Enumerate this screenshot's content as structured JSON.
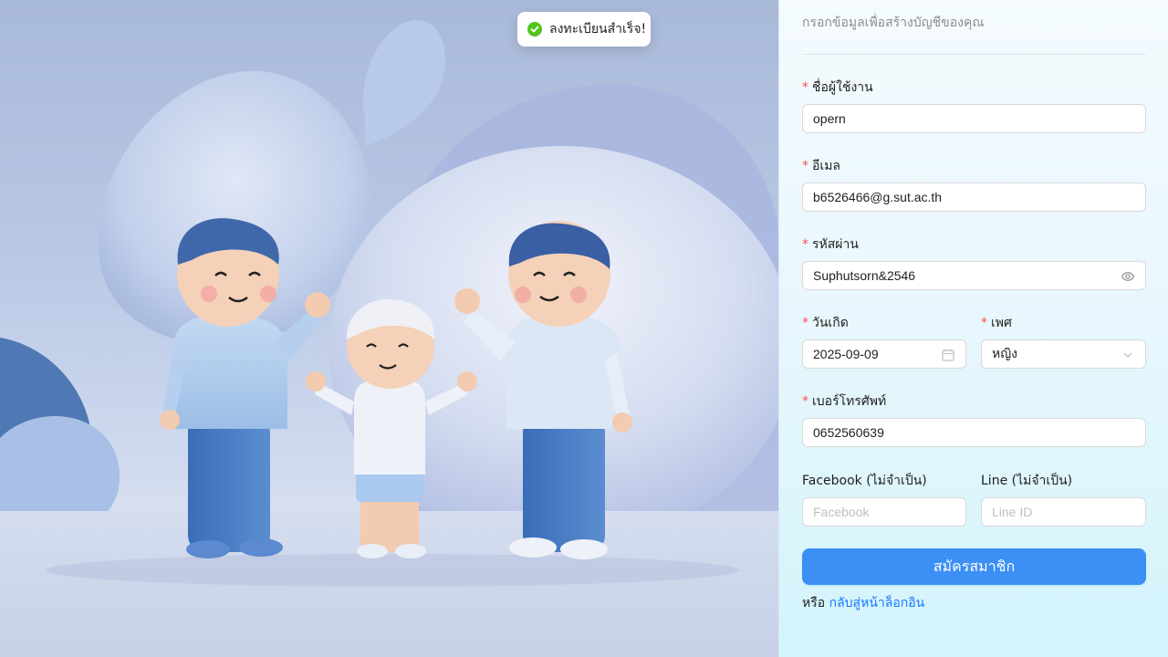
{
  "toast": {
    "message": "ลงทะเบียนสำเร็จ!",
    "icon": "check-circle-icon"
  },
  "form": {
    "subtitle": "กรอกข้อมูลเพื่อสร้างบัญชีของคุณ",
    "username": {
      "label": "ชื่อผู้ใช้งาน",
      "value": "opern"
    },
    "email": {
      "label": "อีเมล",
      "value": "b6526466@g.sut.ac.th"
    },
    "password": {
      "label": "รหัสผ่าน",
      "value": "Suphutsorn&2546",
      "icon": "eye-icon"
    },
    "birthdate": {
      "label": "วันเกิด",
      "value": "2025-09-09",
      "icon": "calendar-icon"
    },
    "gender": {
      "label": "เพศ",
      "value": "หญิง",
      "icon": "chevron-down-icon"
    },
    "phone": {
      "label": "เบอร์โทรศัพท์",
      "value": "0652560639"
    },
    "facebook": {
      "label": "Facebook (ไม่จำเป็น)",
      "placeholder": "Facebook"
    },
    "line": {
      "label": "Line (ไม่จำเป็น)",
      "placeholder": "Line ID"
    },
    "submit_label": "สมัครสมาชิก",
    "alt_prefix": "หรือ",
    "login_link": "กลับสู่หน้าล็อกอิน"
  },
  "colors": {
    "primary": "#3b8ff5",
    "required": "#ff4d4f",
    "link": "#1677ff",
    "success": "#52c41a"
  }
}
